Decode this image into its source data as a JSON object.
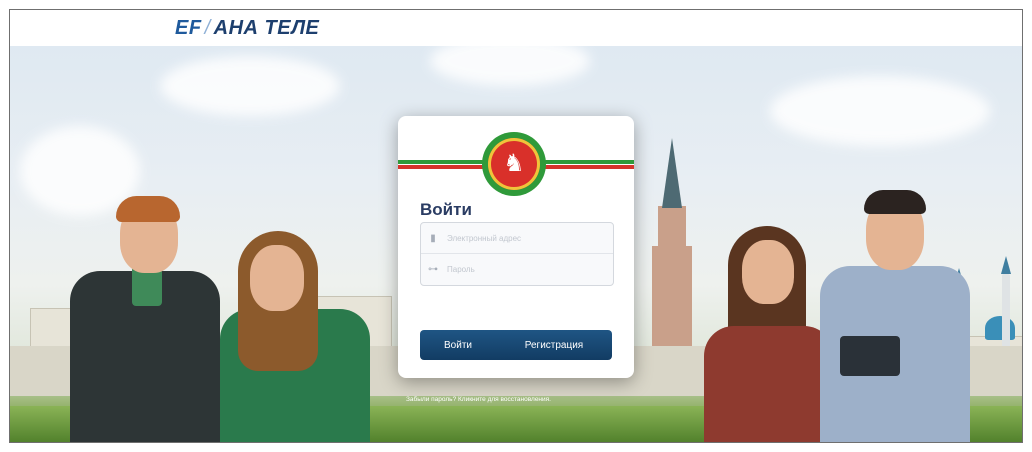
{
  "header": {
    "brand_prefix": "EF",
    "brand_separator": "/",
    "brand_name": "АНА ТЕЛЕ"
  },
  "login": {
    "title": "Войти",
    "login_placeholder": "Электронный адрес",
    "password_placeholder": "Пароль",
    "login_button": "Войти",
    "register_button": "Регистрация",
    "forgot_text": "Забыли пароль? Кликните для восстановления."
  },
  "icons": {
    "user_field": "user-icon",
    "password_field": "key-icon",
    "emblem": "tatarstan-emblem-icon"
  },
  "colors": {
    "brand": "#1f5a9c",
    "button": "#123c63",
    "stripe_green": "#2f9a3a",
    "stripe_red": "#d6342c"
  }
}
